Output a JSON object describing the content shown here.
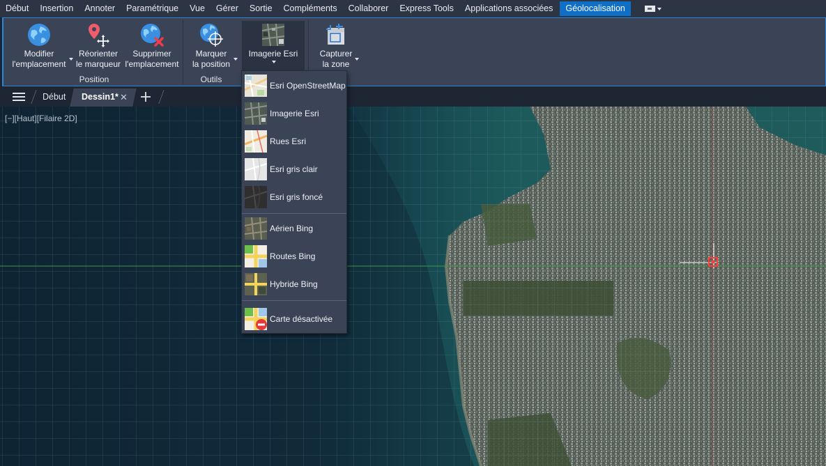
{
  "ribbon_tabs": [
    "Début",
    "Insertion",
    "Annoter",
    "Paramétrique",
    "Vue",
    "Gérer",
    "Sortie",
    "Compléments",
    "Collaborer",
    "Express Tools",
    "Applications associées",
    "Géolocalisation"
  ],
  "active_tab": "Géolocalisation",
  "ribbon": {
    "modifier": {
      "line1": "Modifier",
      "line2": "l'emplacement"
    },
    "reorienter": {
      "line1": "Réorienter",
      "line2": "le marqueur"
    },
    "supprimer": {
      "line1": "Supprimer",
      "line2": "l'emplacement"
    },
    "marquer": {
      "line1": "Marquer",
      "line2": "la position"
    },
    "imagerie": {
      "line1": "Imagerie Esri"
    },
    "capturer": {
      "line1": "Capturer",
      "line2": "la zone"
    },
    "group_position": "Position",
    "group_outils": "Outils"
  },
  "doc_tabs": {
    "home": "Début",
    "drawing": "Dessin1*"
  },
  "viewport": {
    "label": "[−][Haut][Filaire 2D]"
  },
  "menu_items": [
    {
      "label": "Esri OpenStreetMap",
      "icon": "osm-map-thumbnail"
    },
    {
      "label": "Imagerie Esri",
      "icon": "esri-imagery-thumbnail"
    },
    {
      "label": "Rues Esri",
      "icon": "esri-streets-thumbnail"
    },
    {
      "label": "Esri gris clair",
      "icon": "esri-light-gray-thumbnail"
    },
    {
      "label": "Esri gris foncé",
      "icon": "esri-dark-gray-thumbnail"
    },
    {
      "label": "Aérien Bing",
      "icon": "bing-aerial-thumbnail"
    },
    {
      "label": "Routes Bing",
      "icon": "bing-roads-thumbnail"
    },
    {
      "label": "Hybride Bing",
      "icon": "bing-hybrid-thumbnail"
    },
    {
      "label": "Carte désactivée",
      "icon": "map-off-icon"
    }
  ],
  "colors": {
    "accent": "#0f6fc7",
    "ribbon_bg": "#3b4457",
    "tabbar_bg": "#2d3545",
    "ocean": "#10283a",
    "land": "#4e5a48"
  }
}
